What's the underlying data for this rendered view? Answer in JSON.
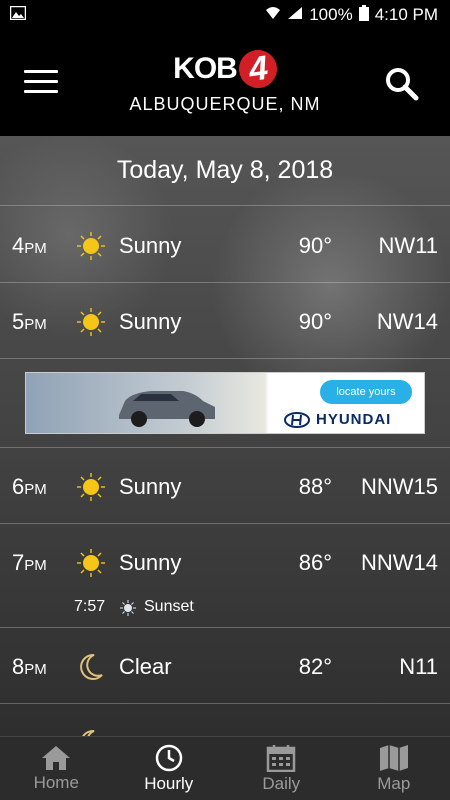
{
  "status": {
    "battery": "100%",
    "time": "4:10 PM"
  },
  "header": {
    "logo_text": "KOB",
    "logo_num": "4",
    "city": "ALBUQUERQUE, NM"
  },
  "date": "Today, May 8, 2018",
  "hours": [
    {
      "hour": "4",
      "ampm": "PM",
      "icon": "sun-icon",
      "condition": "Sunny",
      "temp": "90°",
      "wind": "NW11"
    },
    {
      "hour": "5",
      "ampm": "PM",
      "icon": "sun-icon",
      "condition": "Sunny",
      "temp": "90°",
      "wind": "NW14"
    },
    {
      "hour": "6",
      "ampm": "PM",
      "icon": "sun-icon",
      "condition": "Sunny",
      "temp": "88°",
      "wind": "NNW15"
    },
    {
      "hour": "7",
      "ampm": "PM",
      "icon": "sun-icon",
      "condition": "Sunny",
      "temp": "86°",
      "wind": "NNW14",
      "event": {
        "time": "7:57",
        "label": "Sunset"
      }
    },
    {
      "hour": "8",
      "ampm": "PM",
      "icon": "moon-icon",
      "condition": "Clear",
      "temp": "82°",
      "wind": "N11"
    }
  ],
  "ad": {
    "cta": "locate yours",
    "brand": "HYUNDAI"
  },
  "tabs": [
    {
      "label": "Home",
      "icon": "home-icon"
    },
    {
      "label": "Hourly",
      "icon": "clock-icon",
      "active": true
    },
    {
      "label": "Daily",
      "icon": "calendar-icon"
    },
    {
      "label": "Map",
      "icon": "map-icon"
    }
  ],
  "colors": {
    "accent": "#d21f26",
    "sun": "#f5c518",
    "header_bg": "#000000",
    "tab_bg": "#2c2c2c"
  }
}
